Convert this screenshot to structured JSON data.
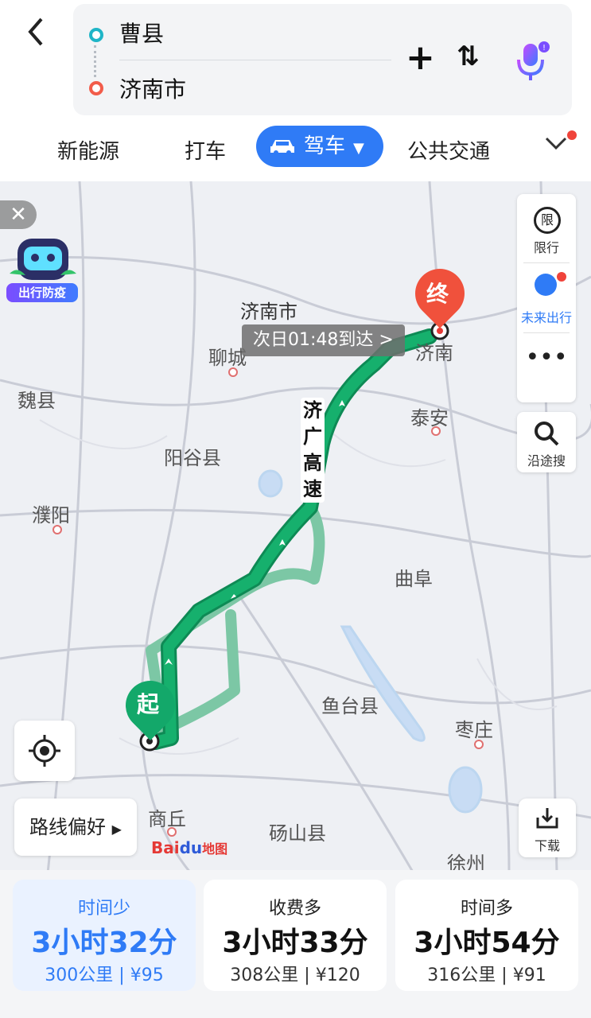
{
  "search": {
    "origin": "曹县",
    "destination": "济南市",
    "add_icon": "plus-icon",
    "swap_icon": "swap-icon",
    "voice_icon": "voice-assistant-icon"
  },
  "tabs": [
    {
      "label": "新能源"
    },
    {
      "label": "打车"
    },
    {
      "label": "驾车",
      "active": true
    },
    {
      "label": "公共交通"
    }
  ],
  "map": {
    "destination_city": "济南市",
    "eta": "次日01:48到达 >",
    "end_marker": "终",
    "start_marker": "起",
    "road_name": "济广高速",
    "places": [
      "济南",
      "聊城",
      "魏县",
      "泰安",
      "阳谷县",
      "濮阳",
      "曲阜",
      "鱼台县",
      "枣庄",
      "商丘",
      "砀山县",
      "徐州"
    ],
    "promo": "出行防疫",
    "side": {
      "limit": "限行",
      "limit_icon": "限",
      "future": "未来出行",
      "search_along": "沿途搜",
      "download": "下载"
    },
    "preference": "路线偏好",
    "logo_a": "Bai",
    "logo_b": "du",
    "logo_c": "地图"
  },
  "routes": [
    {
      "title": "时间少",
      "time": "3小时32分",
      "dist": "300公里",
      "price": "¥95",
      "selected": true
    },
    {
      "title": "收费多",
      "time": "3小时33分",
      "dist": "308公里",
      "price": "¥120"
    },
    {
      "title": "时间多",
      "time": "3小时54分",
      "dist": "316公里",
      "price": "¥91"
    }
  ],
  "colors": {
    "accent": "#2f7bf6",
    "route": "#13a86a",
    "alt_route": "#7cc7a5",
    "dest": "#f0513c"
  }
}
